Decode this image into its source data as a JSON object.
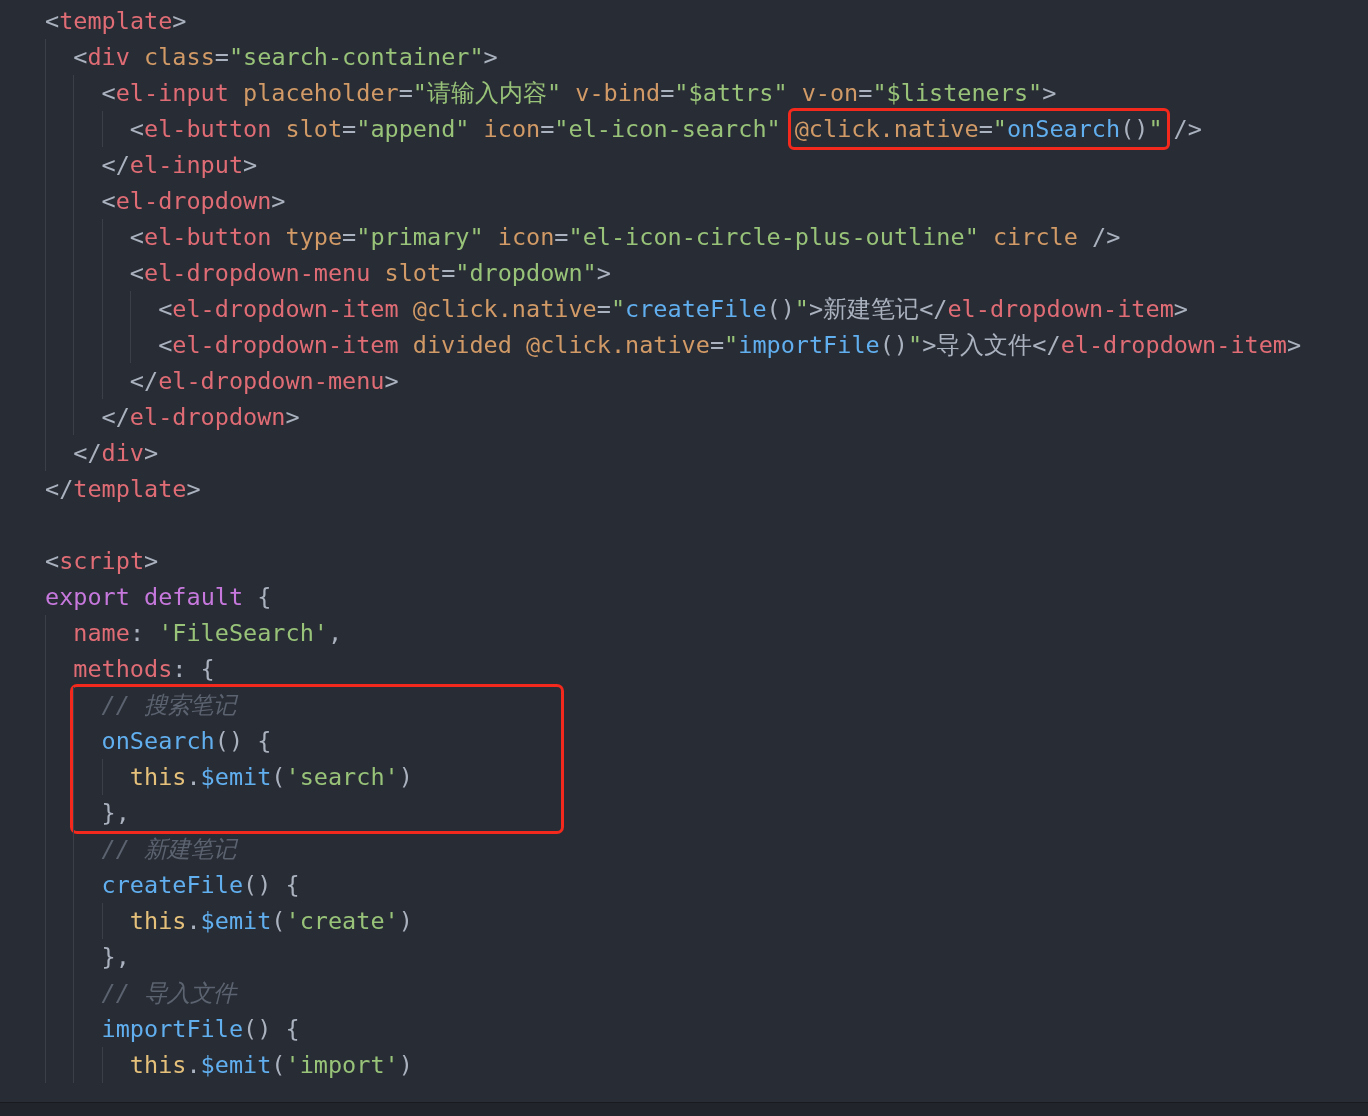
{
  "editor": {
    "lines": [
      {
        "kind": "line",
        "tokens": [
          {
            "kind": "punct",
            "text": "<"
          },
          {
            "kind": "tag",
            "text": "template"
          },
          {
            "kind": "punct",
            "text": ">"
          }
        ],
        "children": [
          {
            "kind": "line",
            "tokens": [
              {
                "kind": "punct",
                "text": "<"
              },
              {
                "kind": "tag",
                "text": "div"
              },
              {
                "kind": "attr",
                "text": " class"
              },
              {
                "kind": "punct",
                "text": "="
              },
              {
                "kind": "string",
                "text": "\"search-container\""
              },
              {
                "kind": "punct",
                "text": ">"
              }
            ],
            "children": [
              {
                "kind": "line",
                "tokens": [
                  {
                    "kind": "punct",
                    "text": "<"
                  },
                  {
                    "kind": "tag",
                    "text": "el-input"
                  },
                  {
                    "kind": "attr",
                    "text": " placeholder"
                  },
                  {
                    "kind": "punct",
                    "text": "="
                  },
                  {
                    "kind": "string",
                    "text": "\"请输入内容\""
                  },
                  {
                    "kind": "attr",
                    "text": " v-bind"
                  },
                  {
                    "kind": "punct",
                    "text": "="
                  },
                  {
                    "kind": "string",
                    "text": "\"$attrs\""
                  },
                  {
                    "kind": "attr",
                    "text": " v-on"
                  },
                  {
                    "kind": "punct",
                    "text": "="
                  },
                  {
                    "kind": "string",
                    "text": "\"$listeners\""
                  },
                  {
                    "kind": "punct",
                    "text": ">"
                  }
                ],
                "children": [
                  {
                    "kind": "line",
                    "tokens": [
                      {
                        "kind": "punct",
                        "text": "<"
                      },
                      {
                        "kind": "tag",
                        "text": "el-button"
                      },
                      {
                        "kind": "attr",
                        "text": " slot"
                      },
                      {
                        "kind": "punct",
                        "text": "="
                      },
                      {
                        "kind": "string",
                        "text": "\"append\""
                      },
                      {
                        "kind": "attr",
                        "text": " icon"
                      },
                      {
                        "kind": "punct",
                        "text": "="
                      },
                      {
                        "kind": "string",
                        "text": "\"el-icon-search\""
                      }
                    ],
                    "boxed_tokens": [
                      {
                        "kind": "attr",
                        "text": "@click.native"
                      },
                      {
                        "kind": "punct",
                        "text": "="
                      },
                      {
                        "kind": "string",
                        "text": "\""
                      },
                      {
                        "kind": "func",
                        "text": "onSearch"
                      },
                      {
                        "kind": "punct",
                        "text": "()"
                      },
                      {
                        "kind": "string",
                        "text": "\""
                      }
                    ],
                    "after_tokens": [
                      {
                        "kind": "punct",
                        "text": "/>"
                      }
                    ]
                  }
                ]
              },
              {
                "kind": "line",
                "tokens": [
                  {
                    "kind": "punct",
                    "text": "</"
                  },
                  {
                    "kind": "tag",
                    "text": "el-input"
                  },
                  {
                    "kind": "punct",
                    "text": ">"
                  }
                ]
              },
              {
                "kind": "line",
                "tokens": [
                  {
                    "kind": "punct",
                    "text": "<"
                  },
                  {
                    "kind": "tag",
                    "text": "el-dropdown"
                  },
                  {
                    "kind": "punct",
                    "text": ">"
                  }
                ],
                "children": [
                  {
                    "kind": "line",
                    "tokens": [
                      {
                        "kind": "punct",
                        "text": "<"
                      },
                      {
                        "kind": "tag",
                        "text": "el-button"
                      },
                      {
                        "kind": "attr",
                        "text": " type"
                      },
                      {
                        "kind": "punct",
                        "text": "="
                      },
                      {
                        "kind": "string",
                        "text": "\"primary\""
                      },
                      {
                        "kind": "attr",
                        "text": " icon"
                      },
                      {
                        "kind": "punct",
                        "text": "="
                      },
                      {
                        "kind": "string",
                        "text": "\"el-icon-circle-plus-outline\""
                      },
                      {
                        "kind": "attr",
                        "text": " circle"
                      },
                      {
                        "kind": "punct",
                        "text": " />"
                      }
                    ]
                  },
                  {
                    "kind": "line",
                    "tokens": [
                      {
                        "kind": "punct",
                        "text": "<"
                      },
                      {
                        "kind": "tag",
                        "text": "el-dropdown-menu"
                      },
                      {
                        "kind": "attr",
                        "text": " slot"
                      },
                      {
                        "kind": "punct",
                        "text": "="
                      },
                      {
                        "kind": "string",
                        "text": "\"dropdown\""
                      },
                      {
                        "kind": "punct",
                        "text": ">"
                      }
                    ],
                    "children": [
                      {
                        "kind": "line",
                        "tokens": [
                          {
                            "kind": "punct",
                            "text": "<"
                          },
                          {
                            "kind": "tag",
                            "text": "el-dropdown-item"
                          },
                          {
                            "kind": "attr",
                            "text": " @click.native"
                          },
                          {
                            "kind": "punct",
                            "text": "="
                          },
                          {
                            "kind": "string",
                            "text": "\""
                          },
                          {
                            "kind": "func",
                            "text": "createFile"
                          },
                          {
                            "kind": "punct",
                            "text": "()"
                          },
                          {
                            "kind": "string",
                            "text": "\""
                          },
                          {
                            "kind": "punct",
                            "text": ">新建笔记</"
                          },
                          {
                            "kind": "tag",
                            "text": "el-dropdown-item"
                          },
                          {
                            "kind": "punct",
                            "text": ">"
                          }
                        ]
                      },
                      {
                        "kind": "line",
                        "tokens": [
                          {
                            "kind": "punct",
                            "text": "<"
                          },
                          {
                            "kind": "tag",
                            "text": "el-dropdown-item"
                          },
                          {
                            "kind": "attr",
                            "text": " divided @click.native"
                          },
                          {
                            "kind": "punct",
                            "text": "="
                          },
                          {
                            "kind": "string",
                            "text": "\""
                          },
                          {
                            "kind": "func",
                            "text": "importFile"
                          },
                          {
                            "kind": "punct",
                            "text": "()"
                          },
                          {
                            "kind": "string",
                            "text": "\""
                          },
                          {
                            "kind": "punct",
                            "text": ">导入文件</"
                          },
                          {
                            "kind": "tag",
                            "text": "el-dropdown-item"
                          },
                          {
                            "kind": "punct",
                            "text": ">"
                          }
                        ]
                      }
                    ]
                  },
                  {
                    "kind": "line",
                    "tokens": [
                      {
                        "kind": "punct",
                        "text": "</"
                      },
                      {
                        "kind": "tag",
                        "text": "el-dropdown-menu"
                      },
                      {
                        "kind": "punct",
                        "text": ">"
                      }
                    ]
                  }
                ]
              },
              {
                "kind": "line",
                "tokens": [
                  {
                    "kind": "punct",
                    "text": "</"
                  },
                  {
                    "kind": "tag",
                    "text": "el-dropdown"
                  },
                  {
                    "kind": "punct",
                    "text": ">"
                  }
                ]
              }
            ]
          },
          {
            "kind": "line",
            "tokens": [
              {
                "kind": "punct",
                "text": "</"
              },
              {
                "kind": "tag",
                "text": "div"
              },
              {
                "kind": "punct",
                "text": ">"
              }
            ]
          }
        ]
      },
      {
        "kind": "line",
        "tokens": [
          {
            "kind": "punct",
            "text": "</"
          },
          {
            "kind": "tag",
            "text": "template"
          },
          {
            "kind": "punct",
            "text": ">"
          }
        ]
      },
      {
        "kind": "blank"
      },
      {
        "kind": "line",
        "tokens": [
          {
            "kind": "punct",
            "text": "<"
          },
          {
            "kind": "tag",
            "text": "script"
          },
          {
            "kind": "punct",
            "text": ">"
          }
        ]
      },
      {
        "kind": "line",
        "tokens": [
          {
            "kind": "keyword",
            "text": "export default"
          },
          {
            "kind": "punct",
            "text": " {"
          }
        ],
        "children": [
          {
            "kind": "line",
            "tokens": [
              {
                "kind": "tag",
                "text": "name"
              },
              {
                "kind": "punct",
                "text": ": "
              },
              {
                "kind": "string",
                "text": "'FileSearch'"
              },
              {
                "kind": "punct",
                "text": ","
              }
            ]
          },
          {
            "kind": "line",
            "tokens": [
              {
                "kind": "tag",
                "text": "methods"
              },
              {
                "kind": "punct",
                "text": ": {"
              }
            ],
            "children": [
              {
                "kind": "group",
                "lines": [
                  {
                    "kind": "line",
                    "tokens": [
                      {
                        "kind": "comment",
                        "text": "// 搜索笔记"
                      }
                    ]
                  },
                  {
                    "kind": "line",
                    "tokens": [
                      {
                        "kind": "func",
                        "text": "onSearch"
                      },
                      {
                        "kind": "punct",
                        "text": "() {"
                      }
                    ],
                    "children": [
                      {
                        "kind": "line",
                        "tokens": [
                          {
                            "kind": "this",
                            "text": "this"
                          },
                          {
                            "kind": "punct",
                            "text": "."
                          },
                          {
                            "kind": "func",
                            "text": "$emit"
                          },
                          {
                            "kind": "punct",
                            "text": "("
                          },
                          {
                            "kind": "string",
                            "text": "'search'"
                          },
                          {
                            "kind": "punct",
                            "text": ")"
                          }
                        ]
                      }
                    ]
                  },
                  {
                    "kind": "line",
                    "tokens": [
                      {
                        "kind": "punct",
                        "text": "},"
                      }
                    ]
                  }
                ]
              },
              {
                "kind": "line",
                "tokens": [
                  {
                    "kind": "comment",
                    "text": "// 新建笔记"
                  }
                ]
              },
              {
                "kind": "line",
                "tokens": [
                  {
                    "kind": "func",
                    "text": "createFile"
                  },
                  {
                    "kind": "punct",
                    "text": "() {"
                  }
                ],
                "children": [
                  {
                    "kind": "line",
                    "tokens": [
                      {
                        "kind": "this",
                        "text": "this"
                      },
                      {
                        "kind": "punct",
                        "text": "."
                      },
                      {
                        "kind": "func",
                        "text": "$emit"
                      },
                      {
                        "kind": "punct",
                        "text": "("
                      },
                      {
                        "kind": "string",
                        "text": "'create'"
                      },
                      {
                        "kind": "punct",
                        "text": ")"
                      }
                    ]
                  }
                ]
              },
              {
                "kind": "line",
                "tokens": [
                  {
                    "kind": "punct",
                    "text": "},"
                  }
                ]
              },
              {
                "kind": "line",
                "tokens": [
                  {
                    "kind": "comment",
                    "text": "// 导入文件"
                  }
                ]
              },
              {
                "kind": "line",
                "tokens": [
                  {
                    "kind": "func",
                    "text": "importFile"
                  },
                  {
                    "kind": "punct",
                    "text": "() {"
                  }
                ],
                "children": [
                  {
                    "kind": "line",
                    "tokens": [
                      {
                        "kind": "this",
                        "text": "this"
                      },
                      {
                        "kind": "punct",
                        "text": "."
                      },
                      {
                        "kind": "func",
                        "text": "$emit"
                      },
                      {
                        "kind": "punct",
                        "text": "("
                      },
                      {
                        "kind": "string",
                        "text": "'import'"
                      },
                      {
                        "kind": "punct",
                        "text": ")"
                      }
                    ]
                  }
                ]
              }
            ]
          }
        ]
      }
    ]
  }
}
